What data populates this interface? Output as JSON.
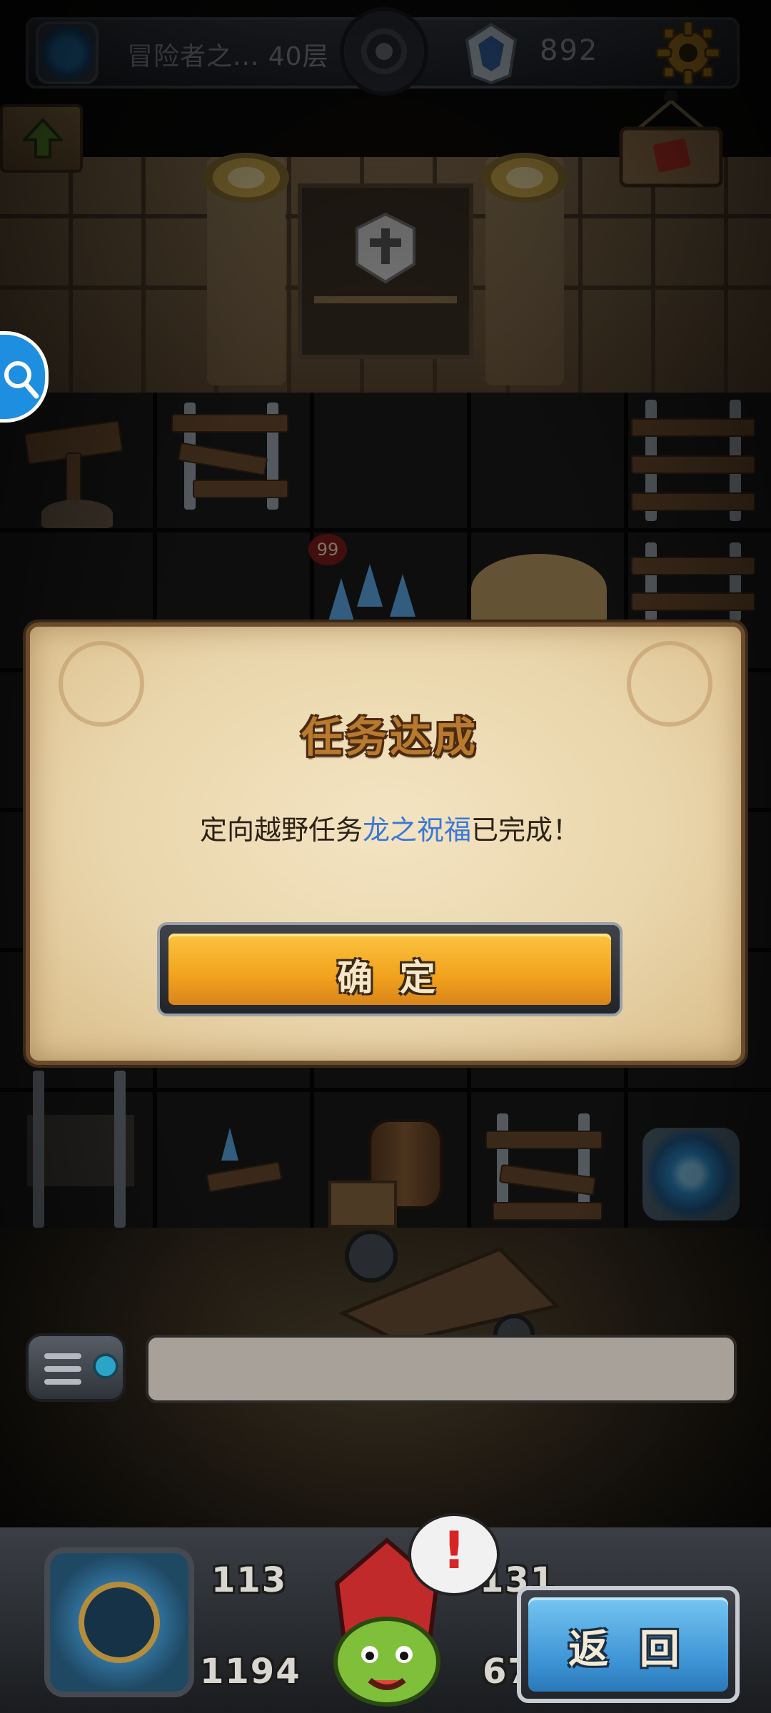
{
  "topbar": {
    "floor_text": "冒险者之... 40层",
    "coins": "892"
  },
  "scene": {
    "item_count_badge": "99"
  },
  "modal": {
    "title": "任务达成",
    "message_prefix": "定向越野任务",
    "message_highlight": "龙之祝福",
    "message_suffix": "已完成！",
    "confirm_label": "确 定",
    "highlight_color": "#3b78d8"
  },
  "bottom": {
    "stat_top_left": "113",
    "stat_bottom_left": "1194",
    "stat_top_right": "131",
    "stat_bottom_right": "67",
    "alert_mark": "!",
    "back_label": "返 回",
    "back_color": "#3c93d4"
  }
}
